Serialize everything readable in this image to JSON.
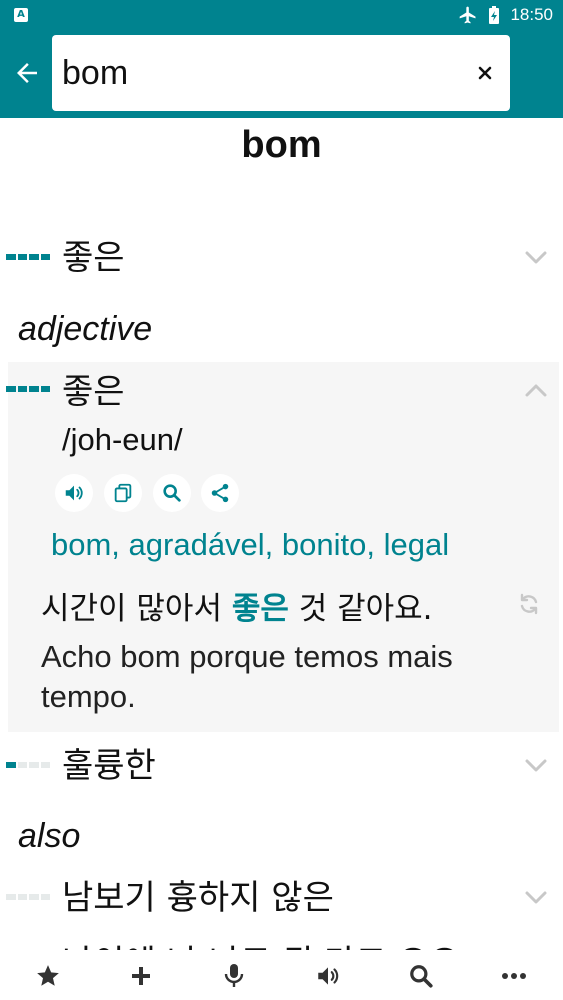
{
  "status_bar": {
    "time": "18:50",
    "left_badge": "A"
  },
  "search": {
    "value": "bom"
  },
  "headword": "bom",
  "senses": [
    {
      "word": "좋은",
      "frequency": 4
    },
    {
      "word": "좋은",
      "frequency": 4,
      "expanded": true
    },
    {
      "word": "훌륭한",
      "frequency": 1
    },
    {
      "word": "남보기 흉하지 않은",
      "frequency": 0
    }
  ],
  "sections": {
    "adjective": "adjective",
    "also": "also"
  },
  "entry": {
    "pronunciation": "/joh-eun/",
    "translation": "bom, agradável, bonito, legal",
    "example_ko_before": "시간이 많아서 ",
    "example_ko_highlight": "좋은",
    "example_ko_after": " 것 같아요.",
    "example_pt": "Acho bom porque temos mais tempo."
  },
  "cut_off_text": "나이에 나 나도 된 마크 오오",
  "icons": {
    "back": "arrow-left-icon",
    "clear": "close-icon",
    "expand": "chevron-down-icon",
    "collapse": "chevron-up-icon",
    "speaker": "speaker-icon",
    "copy": "copy-icon",
    "search": "search-icon",
    "share": "share-icon",
    "refresh": "refresh-icon",
    "favorites": "star-icon",
    "add": "plus-icon",
    "voice": "microphone-icon",
    "audio": "speaker-icon",
    "more": "more-icon"
  },
  "colors": {
    "accent": "#00838f",
    "card": "#f6f6f6",
    "chevron": "#c8c8c8"
  }
}
